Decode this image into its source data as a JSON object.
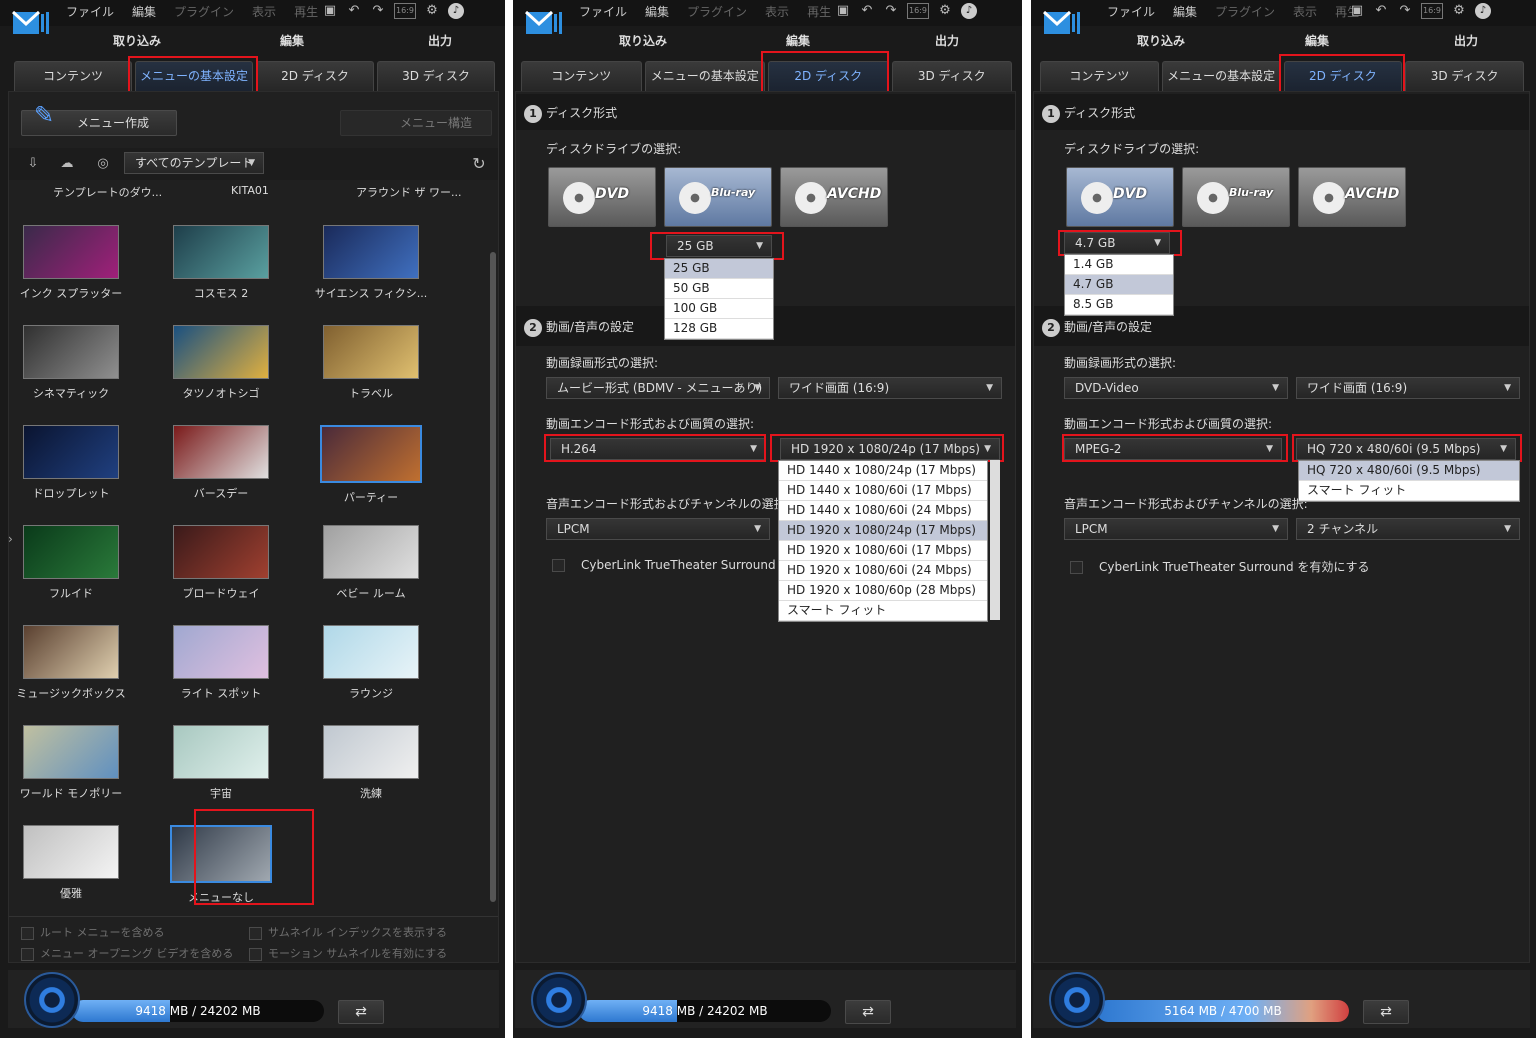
{
  "app": {
    "menu": [
      "ファイル",
      "編集",
      "プラグイン",
      "表示",
      "再生"
    ],
    "modes": [
      "取り込み",
      "編集",
      "出力"
    ],
    "tabs": [
      "コンテンツ",
      "メニューの基本設定",
      "2D ディスク",
      "3D ディスク"
    ],
    "aspect_icon": "16:9"
  },
  "panel1": {
    "create_btn": "メニュー作成",
    "struct_btn": "メニュー構造",
    "filter": "すべてのテンプレート",
    "headers": [
      "テンプレートのダウ...",
      "KITA01",
      "アラウンド ザ ワー..."
    ],
    "templates": [
      "インク スプラッター",
      "コスモス 2",
      "サイエンス フィクシ...",
      "シネマティック",
      "タツノオトシゴ",
      "トラベル",
      "ドロップレット",
      "バースデー",
      "パーティー",
      "フルイド",
      "ブロードウェイ",
      "ベビー ルーム",
      "ミュージックボックス",
      "ライト スポット",
      "ラウンジ",
      "ワールド モノポリー",
      "宇宙",
      "洗練",
      "優雅",
      "メニューなし"
    ],
    "checks": [
      "ルート メニューを含める",
      "サムネイル インデックスを表示する",
      "メニュー オープニング ビデオを含める",
      "モーション サムネイルを有効にする"
    ],
    "usage": "9418 MB / 24202 MB",
    "usage_fraction": 0.39
  },
  "panel2": {
    "sec1": "ディスク形式",
    "drive_label": "ディスクドライブの選択:",
    "discs": [
      "DVD",
      "Blu-ray",
      "AVCHD"
    ],
    "capacity": "25 GB",
    "capacity_options": [
      "25 GB",
      "50 GB",
      "100 GB",
      "128 GB"
    ],
    "sec2": "動画/音声の設定",
    "rec_label": "動画録画形式の選択:",
    "rec_format": "ムービー形式 (BDMV - メニューあり)",
    "aspect": "ワイド画面 (16:9)",
    "enc_label": "動画エンコード形式および画質の選択:",
    "codec": "H.264",
    "quality": "HD 1920 x 1080/24p (17 Mbps)",
    "quality_options": [
      "HD 1440 x 1080/24p (17 Mbps)",
      "HD 1440 x 1080/60i (17 Mbps)",
      "HD 1440 x 1080/60i (24 Mbps)",
      "HD 1920 x 1080/24p (17 Mbps)",
      "HD 1920 x 1080/60i (17 Mbps)",
      "HD 1920 x 1080/60i (24 Mbps)",
      "HD 1920 x 1080/60p (28 Mbps)",
      "スマート フィット"
    ],
    "audio_label": "音声エンコード形式およびチャンネルの選択:",
    "audio": "LPCM",
    "surround": "CyberLink TrueTheater Surround",
    "usage": "9418 MB / 24202 MB",
    "usage_fraction": 0.39
  },
  "panel3": {
    "sec1": "ディスク形式",
    "drive_label": "ディスクドライブの選択:",
    "capacity": "4.7 GB",
    "capacity_options": [
      "1.4 GB",
      "4.7 GB",
      "8.5 GB"
    ],
    "sec2": "動画/音声の設定",
    "rec_label": "動画録画形式の選択:",
    "rec_format": "DVD-Video",
    "aspect": "ワイド画面 (16:9)",
    "enc_label": "動画エンコード形式および画質の選択:",
    "codec": "MPEG-2",
    "quality": "HQ 720 x 480/60i (9.5 Mbps)",
    "quality_options": [
      "HQ 720 x 480/60i (9.5 Mbps)",
      "スマート フィット"
    ],
    "audio_label": "音声エンコード形式およびチャンネルの選択:",
    "audio": "LPCM",
    "channels": "2 チャンネル",
    "surround": "CyberLink TrueTheater Surround を有効にする",
    "usage": "5164 MB / 4700 MB",
    "usage_fraction": 1.0
  }
}
